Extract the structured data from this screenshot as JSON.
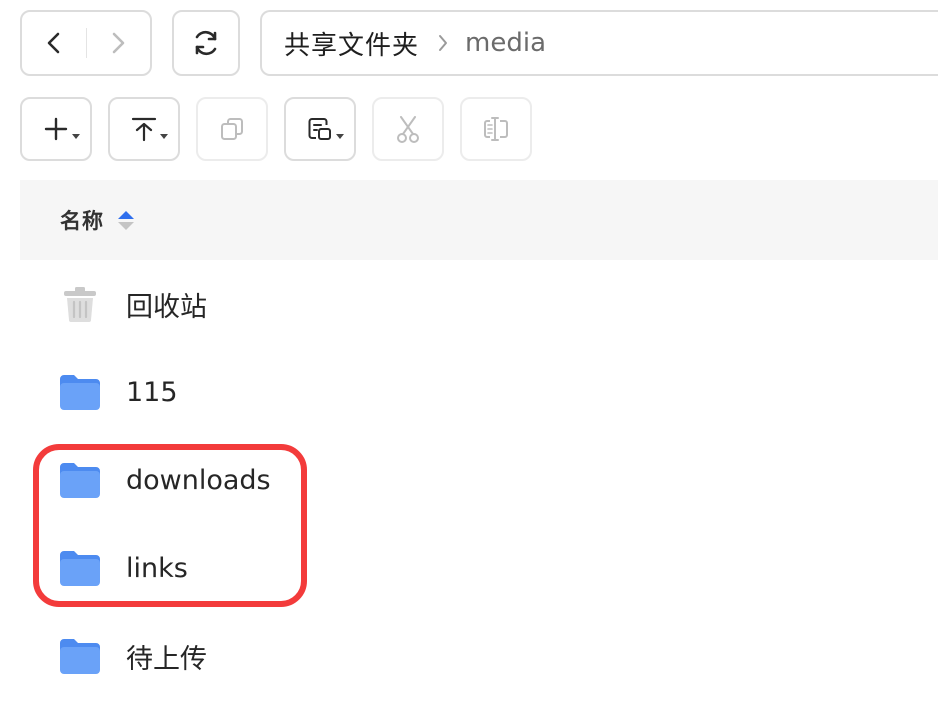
{
  "navigation": {
    "back_icon": "chevron-left-icon",
    "forward_icon": "chevron-right-icon",
    "refresh_icon": "refresh-icon"
  },
  "breadcrumb": {
    "root": "共享文件夹",
    "separator_icon": "chevron-right-icon",
    "current": "media"
  },
  "toolbar": {
    "buttons": [
      {
        "icon": "plus-icon",
        "has_dropdown": true,
        "enabled": true
      },
      {
        "icon": "upload-icon",
        "has_dropdown": true,
        "enabled": true
      },
      {
        "icon": "copy-icon",
        "has_dropdown": false,
        "enabled": false
      },
      {
        "icon": "move-icon",
        "has_dropdown": true,
        "enabled": true
      },
      {
        "icon": "scissors-icon",
        "has_dropdown": false,
        "enabled": false
      },
      {
        "icon": "rename-icon",
        "has_dropdown": false,
        "enabled": false
      }
    ]
  },
  "list": {
    "column_name": "名称",
    "sort_icon": "sort-ascending-icon",
    "items": [
      {
        "name": "回收站",
        "icon": "trash-icon"
      },
      {
        "name": "115",
        "icon": "folder-icon"
      },
      {
        "name": "downloads",
        "icon": "folder-icon"
      },
      {
        "name": "links",
        "icon": "folder-icon"
      },
      {
        "name": "待上传",
        "icon": "folder-icon"
      }
    ]
  },
  "colors": {
    "folder": "#6aa2f8",
    "folder_dark": "#4d8bf0",
    "highlight": "#f33b3b",
    "sort_active": "#2f6fed",
    "border": "#dcdcdc",
    "header_bg": "#f6f6f6"
  }
}
